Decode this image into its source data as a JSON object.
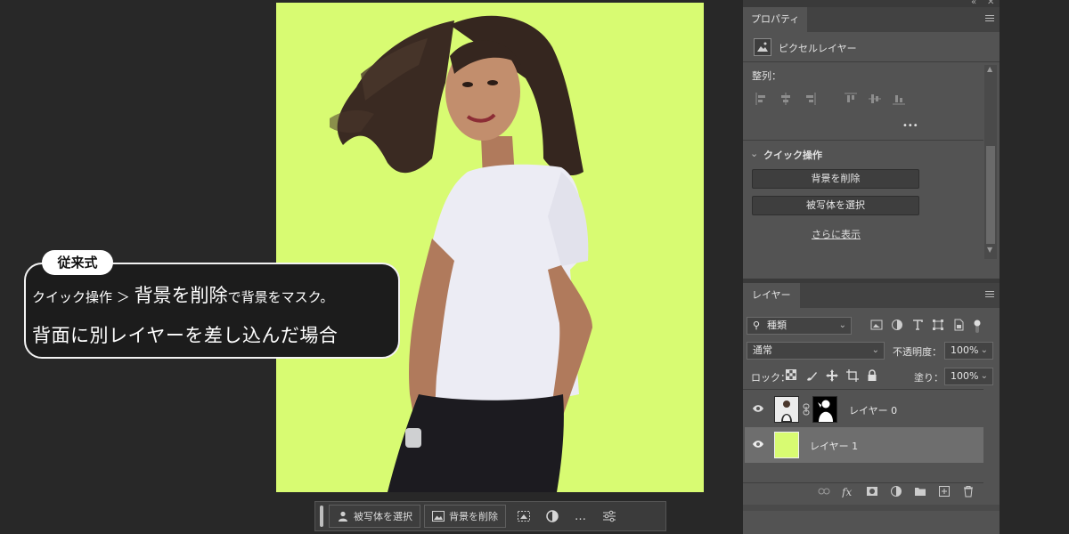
{
  "callout": {
    "tag": "従来式",
    "line1_small_a": "クイック操作 ＞",
    "line1_big": "背景を削除",
    "line1_small_b": "で背景をマスク。",
    "line2": "背面に別レイヤーを差し込んだ場合"
  },
  "canvas": {
    "background_color": "#d8fb72"
  },
  "taskbar": {
    "select_subject": "被写体を選択",
    "remove_background": "背景を削除",
    "more": "…"
  },
  "properties": {
    "tab": "プロパティ",
    "layer_type": "ピクセルレイヤー",
    "align_label": "整列：",
    "more_dots": "•••",
    "quick_actions_title": "クイック操作",
    "remove_background_btn": "背景を削除",
    "select_subject_btn": "被写体を選択",
    "show_more": "さらに表示"
  },
  "layers": {
    "tab": "レイヤー",
    "filter_kind": "種類",
    "blend_mode": "通常",
    "opacity_label": "不透明度：",
    "opacity_value": "100%",
    "lock_label": "ロック：",
    "fill_label": "塗り：",
    "fill_value": "100%",
    "items": [
      {
        "name": "レイヤー 0",
        "visible": true,
        "selected": false,
        "has_mask": true
      },
      {
        "name": "レイヤー 1",
        "visible": true,
        "selected": true,
        "fill_color": "#d8fb72"
      }
    ]
  }
}
